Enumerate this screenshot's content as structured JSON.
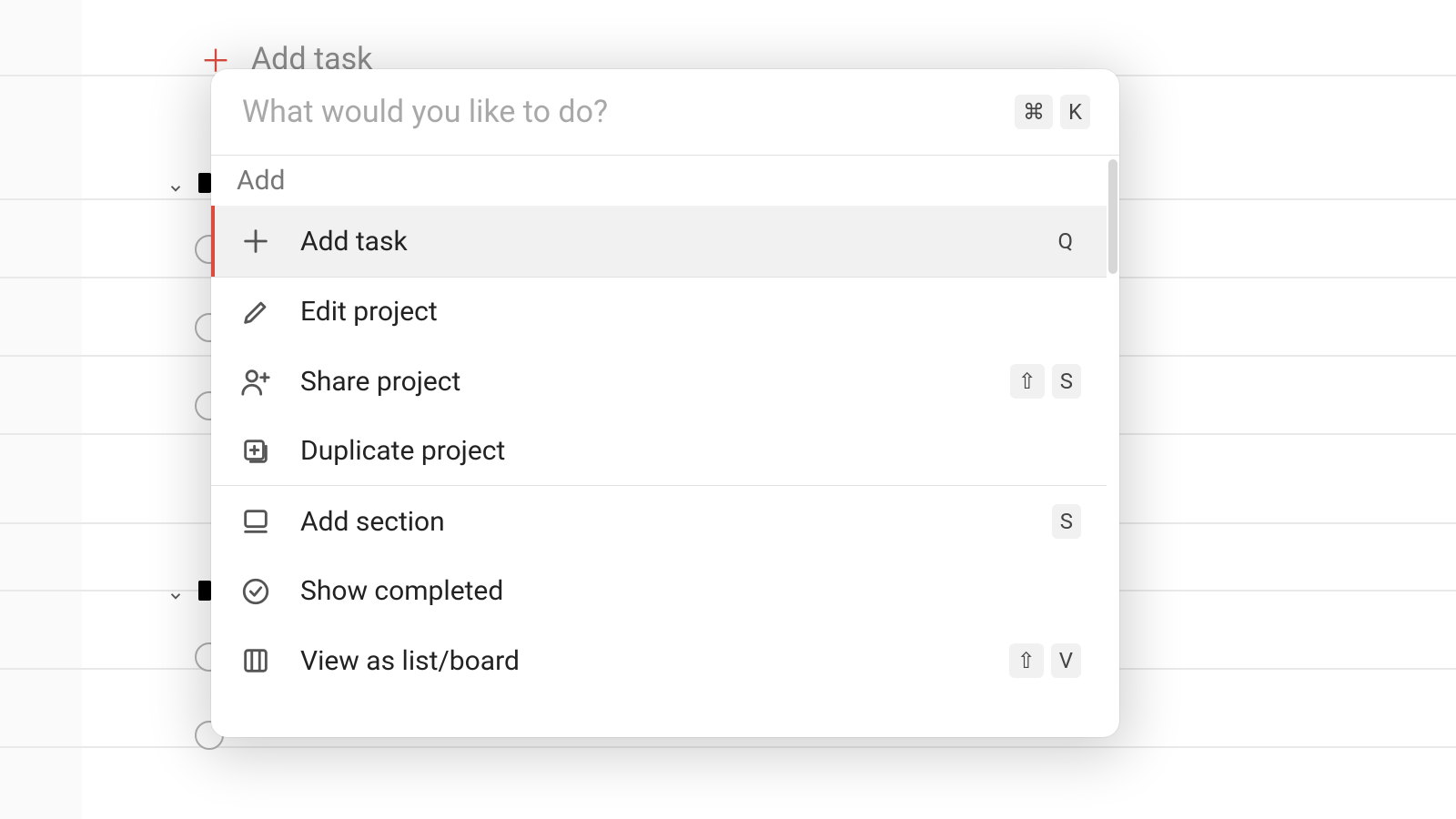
{
  "background": {
    "add_task_label": "Add task"
  },
  "palette": {
    "placeholder": "What would you like to do?",
    "shortcut": [
      "⌘",
      "K"
    ],
    "section_label": "Add",
    "items": [
      {
        "icon": "plus",
        "label": "Add task",
        "shortcut": [
          "Q"
        ],
        "selected": true,
        "separator_after": true
      },
      {
        "icon": "pencil",
        "label": "Edit project",
        "shortcut": [],
        "selected": false,
        "separator_after": false
      },
      {
        "icon": "person-plus",
        "label": "Share project",
        "shortcut": [
          "⇧",
          "S"
        ],
        "selected": false,
        "separator_after": false
      },
      {
        "icon": "duplicate",
        "label": "Duplicate project",
        "shortcut": [],
        "selected": false,
        "separator_after": true
      },
      {
        "icon": "section",
        "label": "Add section",
        "shortcut": [
          "S"
        ],
        "selected": false,
        "separator_after": false
      },
      {
        "icon": "check-circle",
        "label": "Show completed",
        "shortcut": [],
        "selected": false,
        "separator_after": false
      },
      {
        "icon": "board",
        "label": "View as list/board",
        "shortcut": [
          "⇧",
          "V"
        ],
        "selected": false,
        "separator_after": false
      }
    ]
  }
}
